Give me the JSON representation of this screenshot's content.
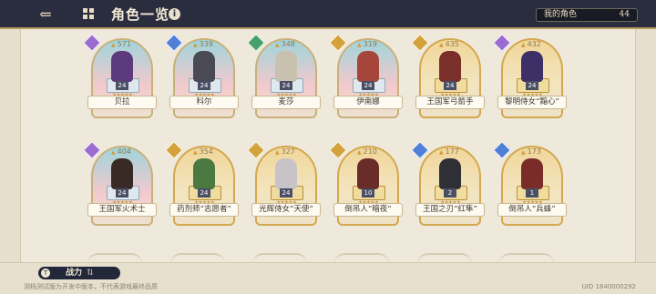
{
  "header": {
    "title": "角色一览",
    "info_icon": "i",
    "count_label": "我的角色",
    "count_value": "44"
  },
  "characters": [
    {
      "name": "贝拉",
      "power": "571",
      "level": "24",
      "element_color": "#9b6bd1",
      "frame": "pink",
      "sprite_color": "#5c3a7c"
    },
    {
      "name": "科尔",
      "power": "339",
      "level": "24",
      "element_color": "#4f7fd6",
      "frame": "pink",
      "sprite_color": "#4a4a55"
    },
    {
      "name": "麦莎",
      "power": "348",
      "level": "24",
      "element_color": "#45a06a",
      "frame": "pink",
      "sprite_color": "#c9c1b0"
    },
    {
      "name": "伊南娜",
      "power": "319",
      "level": "24",
      "element_color": "#d4a23a",
      "frame": "pink",
      "sprite_color": "#a6453a"
    },
    {
      "name": "王国军弓箭手",
      "power": "435",
      "level": "24",
      "element_color": "#d4a23a",
      "frame": "gold",
      "sprite_color": "#7a2f2a"
    },
    {
      "name": "黎明侍女“黯心”",
      "power": "432",
      "level": "24",
      "element_color": "#9b6bd1",
      "frame": "gold",
      "sprite_color": "#3e2f66"
    },
    {
      "name": "王国军火术士",
      "power": "404",
      "level": "24",
      "element_color": "#9b6bd1",
      "frame": "pink",
      "sprite_color": "#3a2a25"
    },
    {
      "name": "药剂师“志愿者”",
      "power": "354",
      "level": "24",
      "element_color": "#d4a23a",
      "frame": "gold",
      "sprite_color": "#4a7a42"
    },
    {
      "name": "光辉侍女“天使”",
      "power": "327",
      "level": "24",
      "element_color": "#d4a23a",
      "frame": "gold",
      "sprite_color": "#c8c3c6"
    },
    {
      "name": "倒吊人“暗夜”",
      "power": "210",
      "level": "10",
      "element_color": "#d4a23a",
      "frame": "gold",
      "sprite_color": "#6a2c28"
    },
    {
      "name": "王国之刃“红隼”",
      "power": "177",
      "level": "2",
      "element_color": "#4f7fd6",
      "frame": "gold",
      "sprite_color": "#2f2f36"
    },
    {
      "name": "倒吊人“兵蜂”",
      "power": "173",
      "level": "1",
      "element_color": "#4f7fd6",
      "frame": "gold",
      "sprite_color": "#7a2c28"
    }
  ],
  "stars": "★★★★★",
  "footer": {
    "filter_icon": "T",
    "filter_label": "战力",
    "disclaimer": "测档测试版为开发中版本，不代表游戏最终品质",
    "uid": "UID 1840000292"
  }
}
